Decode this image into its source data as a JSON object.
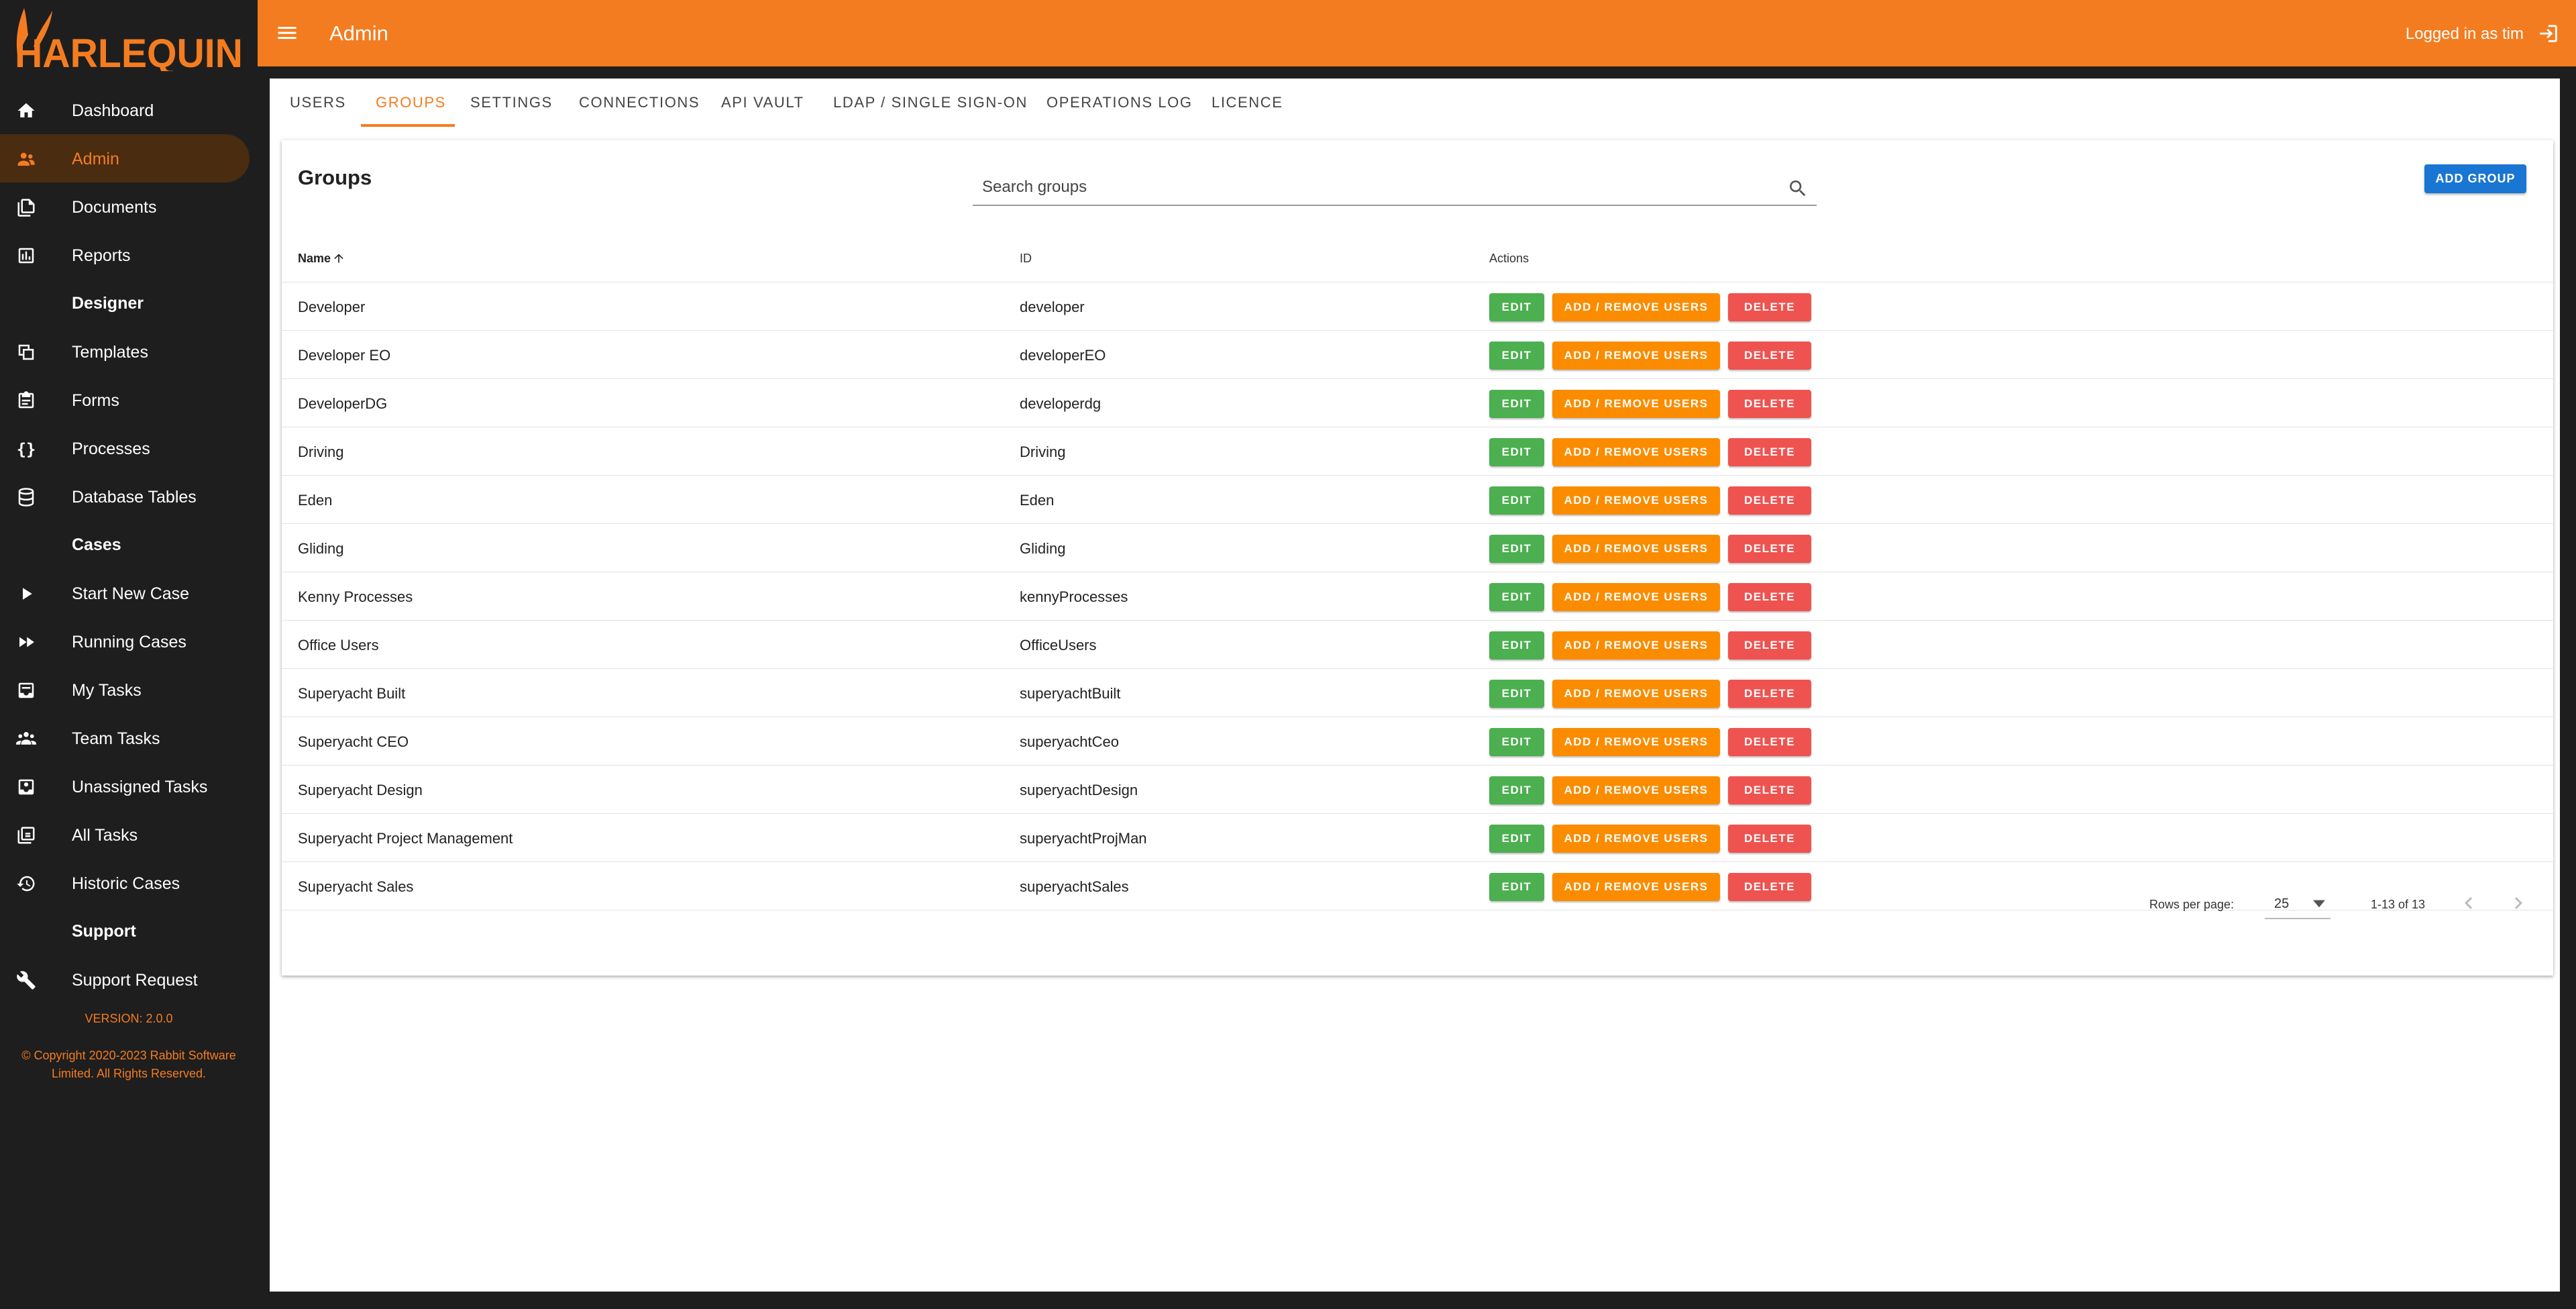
{
  "brand": {
    "name": "HARLEQUIN",
    "accent": "#f47c20",
    "sidebar_bg": "#1e1e1e"
  },
  "header": {
    "title": "Admin",
    "user_text": "Logged in as tim"
  },
  "sidebar": {
    "items": [
      {
        "label": "Dashboard",
        "icon": "home-icon"
      },
      {
        "label": "Admin",
        "icon": "admin-users-icon",
        "active": true
      },
      {
        "label": "Documents",
        "icon": "documents-icon"
      },
      {
        "label": "Reports",
        "icon": "reports-icon"
      }
    ],
    "designer_title": "Designer",
    "designer_items": [
      {
        "label": "Templates",
        "icon": "templates-icon"
      },
      {
        "label": "Forms",
        "icon": "forms-icon"
      },
      {
        "label": "Processes",
        "icon": "processes-icon"
      },
      {
        "label": "Database Tables",
        "icon": "database-icon"
      }
    ],
    "cases_title": "Cases",
    "cases_items": [
      {
        "label": "Start New Case",
        "icon": "play-icon"
      },
      {
        "label": "Running Cases",
        "icon": "fast-forward-icon"
      },
      {
        "label": "My Tasks",
        "icon": "inbox-icon"
      },
      {
        "label": "Team Tasks",
        "icon": "team-icon"
      },
      {
        "label": "Unassigned Tasks",
        "icon": "unassigned-icon"
      },
      {
        "label": "All Tasks",
        "icon": "all-tasks-icon"
      },
      {
        "label": "Historic Cases",
        "icon": "history-icon"
      }
    ],
    "support_title": "Support",
    "support_items": [
      {
        "label": "Support Request",
        "icon": "wrench-icon"
      }
    ],
    "version": "VERSION: 2.0.0",
    "copyright": "© Copyright 2020-2023 Rabbit Software Limited. All Rights Reserved."
  },
  "tabs": [
    "USERS",
    "GROUPS",
    "SETTINGS",
    "CONNECTIONS",
    "API VAULT",
    "LDAP / SINGLE SIGN-ON",
    "OPERATIONS LOG",
    "LICENCE"
  ],
  "active_tab": "GROUPS",
  "groups": {
    "title": "Groups",
    "search_placeholder": "Search groups",
    "add_label": "ADD GROUP",
    "columns": {
      "name": "Name",
      "id": "ID",
      "actions": "Actions"
    },
    "actions": {
      "edit": "EDIT",
      "users": "ADD / REMOVE USERS",
      "delete": "DELETE"
    },
    "rows": [
      {
        "name": "Developer",
        "id": "developer"
      },
      {
        "name": "Developer EO",
        "id": "developerEO"
      },
      {
        "name": "DeveloperDG",
        "id": "developerdg"
      },
      {
        "name": "Driving",
        "id": "Driving"
      },
      {
        "name": "Eden",
        "id": "Eden"
      },
      {
        "name": "Gliding",
        "id": "Gliding"
      },
      {
        "name": "Kenny Processes",
        "id": "kennyProcesses"
      },
      {
        "name": "Office Users",
        "id": "OfficeUsers"
      },
      {
        "name": "Superyacht Built",
        "id": "superyachtBuilt"
      },
      {
        "name": "Superyacht CEO",
        "id": "superyachtCeo"
      },
      {
        "name": "Superyacht Design",
        "id": "superyachtDesign"
      },
      {
        "name": "Superyacht Project Management",
        "id": "superyachtProjMan"
      },
      {
        "name": "Superyacht Sales",
        "id": "superyachtSales"
      }
    ],
    "rows_per_page_label": "Rows per page:",
    "rows_per_page": "25",
    "range": "1-13 of 13"
  }
}
